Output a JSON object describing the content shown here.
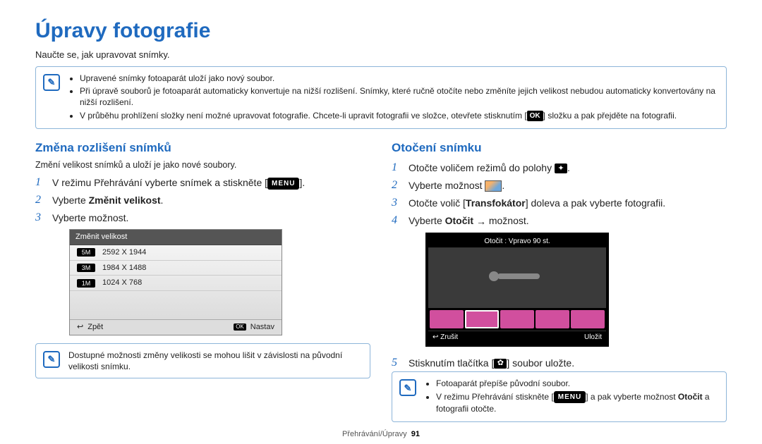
{
  "page": {
    "title": "Úpravy fotografie",
    "intro": "Naučte se, jak upravovat snímky.",
    "footer_section": "Přehrávání/Úpravy",
    "footer_page": "91"
  },
  "top_note": {
    "items": [
      "Upravené snímky fotoaparát uloží jako nový soubor.",
      "Při úpravě souborů je fotoaparát automaticky konvertuje na nižší rozlišení. Snímky, které ručně otočíte nebo změníte jejich velikost nebudou automaticky konvertovány na nižší rozlišení.",
      "V průběhu prohlížení složky není možné upravovat fotografie. Chcete-li upravit fotografii ve složce, otevřete stisknutím ["
    ],
    "item3_tail": "] složku a pak přejděte na fotografii.",
    "icon_text": "OK"
  },
  "left": {
    "heading": "Změna rozlišení snímků",
    "desc": "Změní velikost snímků a uloží je jako nové soubory.",
    "step1_a": "V režimu Přehrávání vyberte snímek a stiskněte [",
    "step1_btn": "MENU",
    "step1_b": "].",
    "step2_a": "Vyberte ",
    "step2_b": "Změnit velikost",
    "step2_c": ".",
    "step3": "Vyberte možnost.",
    "lcd": {
      "title": "Změnit velikost",
      "rows": [
        {
          "badge": "5M",
          "text": "2592 X 1944"
        },
        {
          "badge": "3M",
          "text": "1984 X 1488"
        },
        {
          "badge": "1M",
          "text": "1024 X 768"
        }
      ],
      "back": "Zpět",
      "ok": "OK",
      "set": "Nastav"
    },
    "note": "Dostupné možnosti změny velikosti se mohou lišit v závislosti na původní velikosti snímku."
  },
  "right": {
    "heading": "Otočení snímku",
    "step1": "Otočte voličem režimů do polohy ",
    "step1_tail": ".",
    "step2": "Vyberte možnost ",
    "step2_tail": ".",
    "step3_a": "Otočte volič [",
    "step3_b": "Transfokátor",
    "step3_c": "] doleva a pak vyberte fotografii.",
    "step4_a": "Vyberte ",
    "step4_b": "Otočit",
    "step4_arrow": "→",
    "step4_c": " možnost.",
    "lcd": {
      "title": "Otočit : Vpravo 90 st.",
      "cancel": "Zrušit",
      "save": "Uložit"
    },
    "step5_a": "Stisknutím tlačítka [",
    "step5_b": "] soubor uložte.",
    "note_items": [
      "Fotoaparát přepíše původní soubor.",
      "V režimu Přehrávání stiskněte ["
    ],
    "note_item2_mid": "MENU",
    "note_item2_tail_a": "] a pak vyberte možnost ",
    "note_item2_bold": "Otočit",
    "note_item2_tail_b": " a fotografii otočte."
  }
}
